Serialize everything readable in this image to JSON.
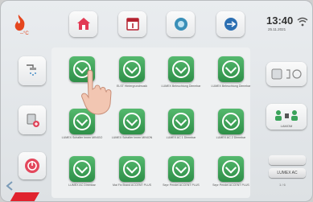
{
  "status": {
    "time": "13:40",
    "date": "25.11.2021"
  },
  "icons": {
    "temp": "flame-icon",
    "wifi": "wifi-icon"
  },
  "top_tiles": [
    {
      "name": "home-tile",
      "icon": "home-icon"
    },
    {
      "name": "calendar-tile",
      "icon": "calendar-icon"
    },
    {
      "name": "camera-tile",
      "icon": "camera-icon"
    },
    {
      "name": "arrows-tile",
      "icon": "arrows-icon"
    }
  ],
  "left_tiles": [
    {
      "name": "shower-tile",
      "icon": "shower-icon"
    },
    {
      "name": "washbasin-tile",
      "icon": "washbasin-icon"
    },
    {
      "name": "power-tile",
      "icon": "power-icon"
    }
  ],
  "grid": {
    "labels": [
      "",
      "ELST Hintergrundmusik",
      "LUMEX Beleuchtung Dimmbar",
      "LUMEX Beleuchtung Dimmbar",
      "LUMEX Schalter Innen MINIGO",
      "LUMEX Schalter Innen MINION",
      "LUMEX AC 1 Dimmbar",
      "LUMEX AC 2 Dimmbar",
      "LUMEX AC Dimmbar",
      "Mal Fix Brand ACCENT PLUS",
      "Sepr Pendel ACCENT PLUS",
      "Sepr Pendel ACCENT PLUS"
    ]
  },
  "right": {
    "button": "LUMEX AC",
    "page": "1 / 6",
    "user_label": "LAMOM"
  }
}
